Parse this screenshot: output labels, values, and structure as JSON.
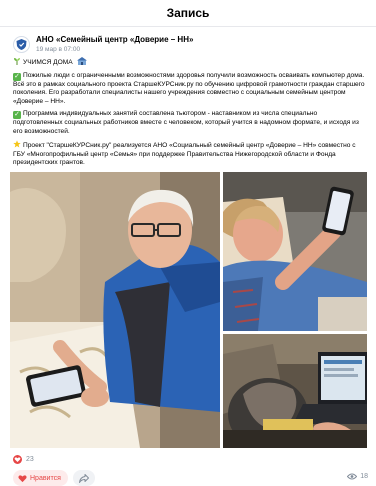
{
  "header": {
    "title": "Запись"
  },
  "post": {
    "author": "АНО «Семейный центр «Доверие – НН»",
    "time": "19 мар в 07:00",
    "paragraphs": {
      "p1": "УЧИМСЯ ДОМА",
      "p2": "Пожилые люди с ограниченными возможностями здоровья получили возможность осваивать компьютер дома. Всё это в рамках социального проекта СтаршеКУРСник.ру по обучению цифровой грамотности граждан старшего поколения. Его разработали специалисты нашего учреждения совместно с социальным семейным центром «Доверие – НН».",
      "p3": "Программа индивидуальных занятий составлена тьютором - наставником из числа специально подготовленных социальных работников вместе с человеком, который учится в надомном формате, и исходя из его возможностей.",
      "p4": "Проект \"СтаршеКУРСник.ру\" реализуется АНО «Социальный семейный центр «Доверие – НН» совместно с ГБУ «Многопрофильный центр «Семья» при поддержке Правительства Нижегородской области и Фонда президентских грантов."
    }
  },
  "stats": {
    "likes": "23",
    "like_label": "Нравится",
    "views": "18"
  },
  "icons": {
    "back": "arrow-left-icon",
    "heart": "heart-icon",
    "share": "share-icon",
    "eye": "eye-icon",
    "check": "check-mark-icon",
    "star": "star-icon",
    "sprout": "sprout-icon",
    "house": "house-icon",
    "avatar": "shield-logo-icon"
  },
  "colors": {
    "accent": "#e64646",
    "check": "#58b44b",
    "muted": "#818c99"
  }
}
